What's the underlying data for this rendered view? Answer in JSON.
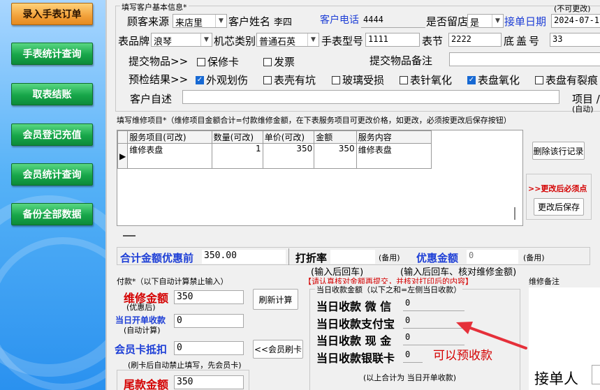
{
  "sidebar": {
    "buttons": [
      {
        "label": "录入手表订单",
        "style": "orange"
      },
      {
        "label": "手表统计查询",
        "style": "green"
      },
      {
        "label": "取表结账",
        "style": "green"
      },
      {
        "label": "会员登记充值",
        "style": "green"
      },
      {
        "label": "会员统计查询",
        "style": "green"
      },
      {
        "label": "备份全部数据",
        "style": "green"
      }
    ]
  },
  "customer": {
    "section_title": "填写客户基本信息*",
    "not_editable_note": "(不可更改)",
    "source_label": "顾客来源",
    "source_value": "来店里",
    "name_label": "客户姓名",
    "name_value": "李四",
    "phone_label": "客户电话",
    "phone_value": "4444",
    "keep_store_label": "是否留店",
    "keep_store_value": "是",
    "order_date_label": "接单日期",
    "order_date_value": "2024-07-1",
    "brand_label": "表品牌",
    "brand_value": "浪琴",
    "movement_label": "机芯类别",
    "movement_value": "普通石英",
    "model_label": "手表型号",
    "model_value": "1111",
    "section_label": "表节",
    "section_value": "2222",
    "caseback_label": "底盖号",
    "caseback_value": "33",
    "submit_label": "提交物品>>",
    "submit_items": [
      {
        "label": "保修卡",
        "checked": false
      },
      {
        "label": "发票",
        "checked": false
      }
    ],
    "submit_note_label": "提交物品备注",
    "precheck_label": "预检结果>>",
    "precheck_items": [
      {
        "label": "外观划伤",
        "checked": true
      },
      {
        "label": "表壳有坑",
        "checked": false
      },
      {
        "label": "玻璃受损",
        "checked": false
      },
      {
        "label": "表针氧化",
        "checked": false
      },
      {
        "label": "表盘氧化",
        "checked": true
      },
      {
        "label": "表盘有裂痕",
        "checked": false
      }
    ],
    "statement_label": "客户自述",
    "item_label": "项目 /",
    "item_auto": "(自动)"
  },
  "repair": {
    "section_title": "填写维修项目*（维修项目金额合计=付款维修金额，在下表服务项目可更改价格，如更改，必须按更改后保存按钮）",
    "columns": [
      "服务项目(可改)",
      "数量(可改)",
      "单价(可改)",
      "金额",
      "服务内容"
    ],
    "rows": [
      {
        "service": "维修表盘",
        "qty": "1",
        "price": "350",
        "amount": "350",
        "content": "维修表盘"
      }
    ],
    "delete_button": "删除该行记录",
    "must_save_note": ">>更改后必须点",
    "save_button": "更改后保存"
  },
  "totals": {
    "total_label": "合计金额优惠前",
    "total_value": "350.00",
    "discount_rate_label": "打折率",
    "discount_rate_hint": "(输入后回车)",
    "reserve1": "(备用)",
    "discount_amount_label": "优惠金额",
    "discount_amount_value": "0",
    "discount_amount_hint": "(输入后回车、核对维修金额)",
    "reserve2": "(备用)"
  },
  "payment": {
    "section_title": "付款*（以下自动计算禁止输入）",
    "notice": "【请认真核对金额再提交，并核对打印后的内容】",
    "repair_amount_label": "维修金额",
    "repair_amount_sub": "(优惠后)",
    "repair_amount_value": "350",
    "recalc_button": "刷新计算",
    "today_order_label": "当日开单收款",
    "today_order_sub": "(自动计算)",
    "today_order_value": "0",
    "member_card_label": "会员卡抵扣",
    "member_card_value": "0",
    "member_swipe_button": "<<会员刷卡",
    "member_card_hint": "(刷卡后自动禁止填写，先会员卡)",
    "balance_label": "尾款金额",
    "balance_value": "350",
    "today_group_title": "当日收款金额（以下之和=左侧当日收款）",
    "wechat_label": "当日收款 微 信",
    "wechat_value": "0",
    "alipay_label": "当日收款支付宝",
    "alipay_value": "0",
    "cash_label": "当日收款 现 金",
    "cash_value": "0",
    "unionpay_label": "当日收款银联卡",
    "unionpay_value": "0",
    "annotation": "可以预收款",
    "sum_note": "(以上合计为 当日开单收款)",
    "repair_remark_label": "维修备注",
    "receiver_label": "接单人"
  },
  "colors": {
    "accent_blue": "#1d3ed6",
    "accent_red": "#d40000",
    "arrow_red": "#e5303a",
    "checked_blue": "#1769d3"
  }
}
